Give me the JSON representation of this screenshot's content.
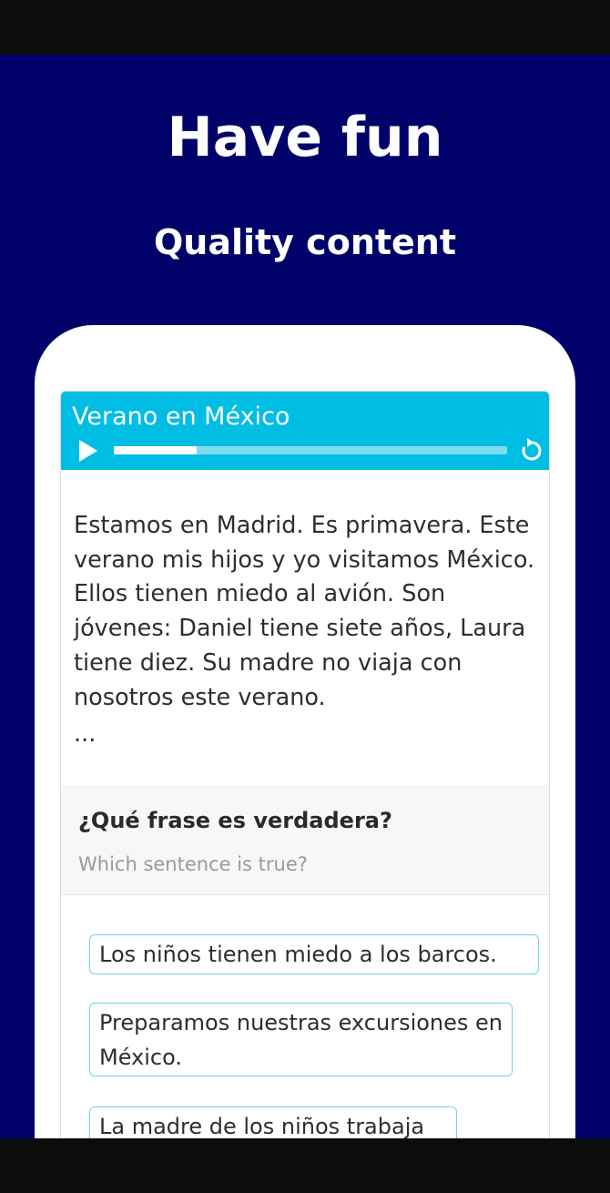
{
  "headline": "Have fun",
  "subheadline": "Quality content",
  "colors": {
    "background": "#01016a",
    "accent": "#00bde3",
    "option_border": "#6fd3ea"
  },
  "player": {
    "title": "Verano en México",
    "play_icon": "play-icon",
    "replay_icon": "replay-icon",
    "progress": 0.21
  },
  "story": {
    "text": "Estamos en Madrid. Es primavera. Este verano mis hijos y yo visitamos México. Ellos tienen miedo al avión. Son jóvenes: Daniel tiene siete años, Laura tiene diez. Su madre no viaja con nosotros este verano.",
    "ellipsis": "..."
  },
  "quiz": {
    "question": "¿Qué frase es verdadera?",
    "translation": "Which sentence is true?",
    "options": [
      "Los niños tienen miedo a los barcos.",
      "Preparamos nuestras excursiones en México.",
      "La madre de los niños trabaja"
    ]
  }
}
